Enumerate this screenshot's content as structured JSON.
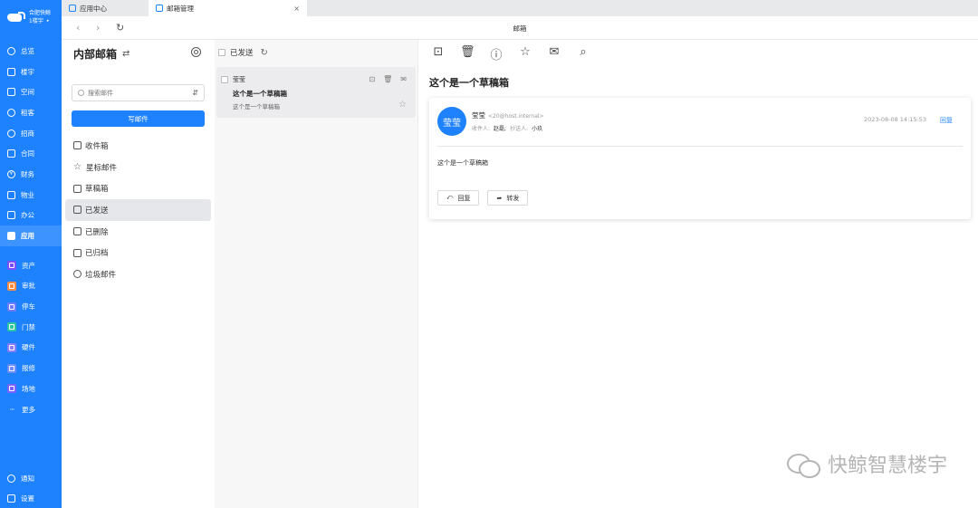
{
  "brand": {
    "name": "合肥快鲸",
    "building": "1楼宇",
    "arrow": "▸"
  },
  "sidebar": {
    "nav": [
      {
        "label": "总览",
        "icon": "overview-icon",
        "glyph": ""
      },
      {
        "label": "楼宇",
        "icon": "building-icon",
        "glyph": ""
      },
      {
        "label": "空间",
        "icon": "space-icon",
        "glyph": ""
      },
      {
        "label": "租客",
        "icon": "tenant-icon",
        "glyph": ""
      },
      {
        "label": "招商",
        "icon": "investment-icon",
        "glyph": ""
      },
      {
        "label": "合同",
        "icon": "contract-icon",
        "glyph": ""
      },
      {
        "label": "财务",
        "icon": "finance-icon",
        "glyph": "¥"
      },
      {
        "label": "物业",
        "icon": "property-icon",
        "glyph": ""
      },
      {
        "label": "办公",
        "icon": "office-icon",
        "glyph": ""
      },
      {
        "label": "应用",
        "icon": "apps-icon",
        "glyph": "",
        "active": true
      }
    ],
    "apps": [
      {
        "label": "资产",
        "color": "#7c4dff"
      },
      {
        "label": "审批",
        "color": "#ff8a3d"
      },
      {
        "label": "停车",
        "color": "#6f7cff"
      },
      {
        "label": "门禁",
        "color": "#2cc7a0"
      },
      {
        "label": "硬件",
        "color": "#8a7dff"
      },
      {
        "label": "报修",
        "color": "#6c8cff"
      },
      {
        "label": "场地",
        "color": "#7b61ff"
      }
    ],
    "more": {
      "label": "更多",
      "glyph": "···"
    },
    "bottom": [
      {
        "label": "通知",
        "icon": "bell-icon"
      },
      {
        "label": "设置",
        "icon": "settings-icon"
      }
    ]
  },
  "tabs": [
    {
      "label": "应用中心"
    },
    {
      "label": "邮箱管理",
      "close": "×"
    }
  ],
  "browser": {
    "back": "‹",
    "forward": "›",
    "reload": "↻",
    "title": "邮箱"
  },
  "folders": {
    "title": "内部邮箱",
    "switch_glyph": "⇄",
    "search_placeholder": "搜索邮件",
    "filter_glyph": "⇵",
    "compose_label": "写邮件",
    "items": [
      {
        "label": "收件箱",
        "icon": "inbox-icon"
      },
      {
        "label": "星标邮件",
        "icon": "star-icon"
      },
      {
        "label": "草稿箱",
        "icon": "draft-icon"
      },
      {
        "label": "已发送",
        "icon": "sent-icon",
        "active": true
      },
      {
        "label": "已删除",
        "icon": "trash-icon"
      },
      {
        "label": "已归档",
        "icon": "archive-icon"
      },
      {
        "label": "垃圾邮件",
        "icon": "spam-icon"
      }
    ]
  },
  "list": {
    "header": "已发送",
    "refresh_glyph": "↻",
    "message": {
      "sender": "莹莹",
      "subject": "这个是一个草稿箱",
      "preview": "这个是一个草稿箱",
      "actions": [
        "⊡",
        "🗑",
        "✉"
      ],
      "star": "☆"
    }
  },
  "reader": {
    "toolbar": [
      "⊡",
      "🗑",
      "ⓘ",
      "☆",
      "✉",
      "⌕"
    ],
    "subject": "这个是一个草稿箱",
    "avatar_text": "莹莹",
    "from_name": "莹莹",
    "from_addr": "<20@host.internal>",
    "to_label": "收件人:",
    "to_value": "赵磊;",
    "cc_label": "抄送人:",
    "cc_value": "小玖",
    "date": "2023-08-08 14:15:53",
    "reply_link": "回复",
    "body": "这个是一个草稿箱",
    "reply_button": "回复",
    "reply_glyph": "⤺",
    "forward_button": "转发",
    "forward_glyph": "➦"
  },
  "watermark": "快鲸智慧楼宇"
}
